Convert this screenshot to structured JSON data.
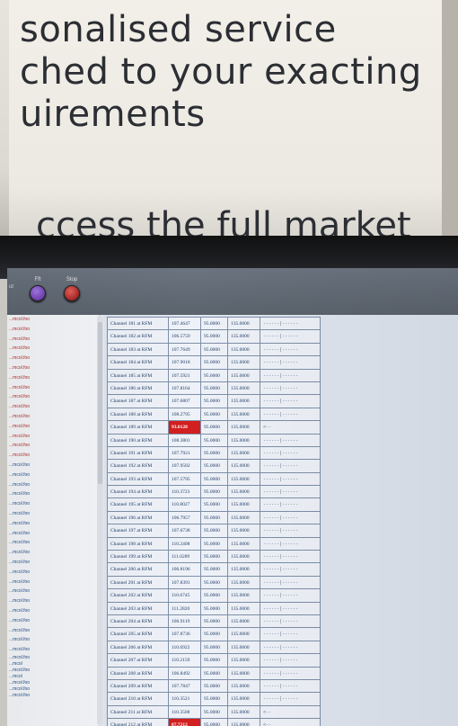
{
  "poster": {
    "lines": [
      "sonalised service",
      "ched to your exacting",
      "uirements"
    ],
    "cut_line": "ccess the full market"
  },
  "toolbar": {
    "left_label": "ut",
    "buttons": [
      {
        "label": "Fft",
        "icon": "purple-circle-icon"
      },
      {
        "label": "Stop",
        "icon": "red-stop-icon"
      }
    ]
  },
  "sidebar": {
    "items": [
      {
        "label": "...mcol.foo",
        "red": true
      },
      {
        "label": "...mcol.foo",
        "red": true
      },
      {
        "label": "...mcol.foo",
        "red": true
      },
      {
        "label": "...mcol.foo",
        "red": true
      },
      {
        "label": "...mcol.foo",
        "red": true
      },
      {
        "label": "...mcol.foo",
        "red": true
      },
      {
        "label": "...mcol.foo",
        "red": true
      },
      {
        "label": "...mcol.foo",
        "red": true
      },
      {
        "label": "...mcol.foo",
        "red": true
      },
      {
        "label": "...mcol.foo",
        "red": true
      },
      {
        "label": "...mcol.foo",
        "red": true
      },
      {
        "label": "...mcol.foo",
        "red": true
      },
      {
        "label": "...mcol.foo",
        "red": true
      },
      {
        "label": "...mcol.foo",
        "red": true
      },
      {
        "label": "...mcol.foo",
        "red": true
      },
      {
        "label": "...mcol.foo",
        "red": false
      },
      {
        "label": "...mcol.foo",
        "red": false
      },
      {
        "label": "...mcol.foo",
        "red": false
      },
      {
        "label": "...mcol.foo",
        "red": false
      },
      {
        "label": "...mcol.foo",
        "red": false
      },
      {
        "label": "...mcol.foo",
        "red": false
      },
      {
        "label": "...mcol.foo",
        "red": false
      },
      {
        "label": "...mcol.foo",
        "red": false
      },
      {
        "label": "...mcol.foo",
        "red": false
      },
      {
        "label": "...mcol.foo",
        "red": false
      },
      {
        "label": "...mcol.foo",
        "red": false
      },
      {
        "label": "...mcol.foo",
        "red": false
      },
      {
        "label": "...mcol.foo",
        "red": false
      },
      {
        "label": "...mcol.foo",
        "red": false
      },
      {
        "label": "...mcol.foo",
        "red": false
      },
      {
        "label": "...mcol.foo",
        "red": false
      },
      {
        "label": "...mcol.foo",
        "red": false
      },
      {
        "label": "...mcol.foo",
        "red": false
      },
      {
        "label": "...mcol.foo",
        "red": false
      },
      {
        "label": "...mcol.foo",
        "red": false
      }
    ],
    "stack_lines": [
      "...mcol.foo",
      "...mcol",
      "...mcol.foo",
      "...mcol",
      "...mcol.foo",
      "...mcol.foo",
      "...mcol.foo"
    ]
  },
  "table": {
    "rows": [
      {
        "name": "Channel 181 at RFM",
        "value": "107.4647",
        "min": "95.0000",
        "max": "135.0000",
        "bar": "------|------",
        "alert": false
      },
      {
        "name": "Channel 182 at RFM",
        "value": "106.5759",
        "min": "95.0000",
        "max": "135.0000",
        "bar": "------|------",
        "alert": false
      },
      {
        "name": "Channel 183 at RFM",
        "value": "107.7649",
        "min": "95.0000",
        "max": "135.0000",
        "bar": "------|------",
        "alert": false
      },
      {
        "name": "Channel 184 at RFM",
        "value": "107.9018",
        "min": "95.0000",
        "max": "135.0000",
        "bar": "------|------",
        "alert": false
      },
      {
        "name": "Channel 185 at RFM",
        "value": "107.5921",
        "min": "95.0000",
        "max": "135.0000",
        "bar": "------|------",
        "alert": false
      },
      {
        "name": "Channel 186 at RFM",
        "value": "107.8164",
        "min": "95.0000",
        "max": "135.0000",
        "bar": "------|------",
        "alert": false
      },
      {
        "name": "Channel 187 at RFM",
        "value": "107.6807",
        "min": "95.0000",
        "max": "135.0000",
        "bar": "------|------",
        "alert": false
      },
      {
        "name": "Channel 188 at RFM",
        "value": "108.2795",
        "min": "95.0000",
        "max": "135.0000",
        "bar": "------|------",
        "alert": false
      },
      {
        "name": "Channel 189 at RFM",
        "value": "93.0128",
        "min": "95.0000",
        "max": "135.0000",
        "bar": "<--",
        "alert": true
      },
      {
        "name": "Channel 190 at RFM",
        "value": "108.3801",
        "min": "95.0000",
        "max": "135.0000",
        "bar": "------|------",
        "alert": false
      },
      {
        "name": "Channel 191 at RFM",
        "value": "107.7921",
        "min": "95.0000",
        "max": "135.0000",
        "bar": "------|------",
        "alert": false
      },
      {
        "name": "Channel 192 at RFM",
        "value": "107.9582",
        "min": "95.0000",
        "max": "135.0000",
        "bar": "------|------",
        "alert": false
      },
      {
        "name": "Channel 193 at RFM",
        "value": "107.5795",
        "min": "95.0000",
        "max": "135.0000",
        "bar": "------|------",
        "alert": false
      },
      {
        "name": "Channel 194 at RFM",
        "value": "110.3723",
        "min": "95.0000",
        "max": "135.0000",
        "bar": "------|------",
        "alert": false
      },
      {
        "name": "Channel 195 at RFM",
        "value": "110.8027",
        "min": "95.0000",
        "max": "135.0000",
        "bar": "------|------",
        "alert": false
      },
      {
        "name": "Channel 196 at RFM",
        "value": "106.7957",
        "min": "95.0000",
        "max": "135.0000",
        "bar": "------|------",
        "alert": false
      },
      {
        "name": "Channel 197 at RFM",
        "value": "107.6738",
        "min": "95.0000",
        "max": "135.0000",
        "bar": "------|------",
        "alert": false
      },
      {
        "name": "Channel 198 at RFM",
        "value": "110.2408",
        "min": "95.0000",
        "max": "135.0000",
        "bar": "------|------",
        "alert": false
      },
      {
        "name": "Channel 199 at RFM",
        "value": "111.0289",
        "min": "95.0000",
        "max": "135.0000",
        "bar": "------|------",
        "alert": false
      },
      {
        "name": "Channel 200 at RFM",
        "value": "106.8196",
        "min": "95.0000",
        "max": "135.0000",
        "bar": "------|------",
        "alert": false
      },
      {
        "name": "Channel 201 at RFM",
        "value": "107.8391",
        "min": "95.0000",
        "max": "135.0000",
        "bar": "------|------",
        "alert": false
      },
      {
        "name": "Channel 202 at RFM",
        "value": "110.6745",
        "min": "95.0000",
        "max": "135.0000",
        "bar": "------|------",
        "alert": false
      },
      {
        "name": "Channel 203 at RFM",
        "value": "111.2820",
        "min": "95.0000",
        "max": "135.0000",
        "bar": "------|------",
        "alert": false
      },
      {
        "name": "Channel 204 at RFM",
        "value": "106.9119",
        "min": "95.0000",
        "max": "135.0000",
        "bar": "------|------",
        "alert": false
      },
      {
        "name": "Channel 205 at RFM",
        "value": "107.8736",
        "min": "95.0000",
        "max": "135.0000",
        "bar": "------|------",
        "alert": false
      },
      {
        "name": "Channel 206 at RFM",
        "value": "110.6922",
        "min": "95.0000",
        "max": "135.0000",
        "bar": "------|------",
        "alert": false
      },
      {
        "name": "Channel 207 at RFM",
        "value": "110.2159",
        "min": "95.0000",
        "max": "135.0000",
        "bar": "------|------",
        "alert": false
      },
      {
        "name": "Channel 208 at RFM",
        "value": "106.8492",
        "min": "95.0000",
        "max": "135.0000",
        "bar": "------|------",
        "alert": false
      },
      {
        "name": "Channel 209 at RFM",
        "value": "107.7847",
        "min": "95.0000",
        "max": "135.0000",
        "bar": "------|------",
        "alert": false
      },
      {
        "name": "Channel 210 at RFM",
        "value": "110.3521",
        "min": "95.0000",
        "max": "135.0000",
        "bar": "------|------",
        "alert": false
      },
      {
        "name": "Channel 211 at RFM",
        "value": "110.3508",
        "min": "95.0000",
        "max": "135.0000",
        "bar": "<--",
        "alert": false
      },
      {
        "name": "Channel 212 at RFM",
        "value": "87.7212",
        "min": "95.0000",
        "max": "135.0000",
        "bar": "<--",
        "alert": true
      }
    ]
  }
}
